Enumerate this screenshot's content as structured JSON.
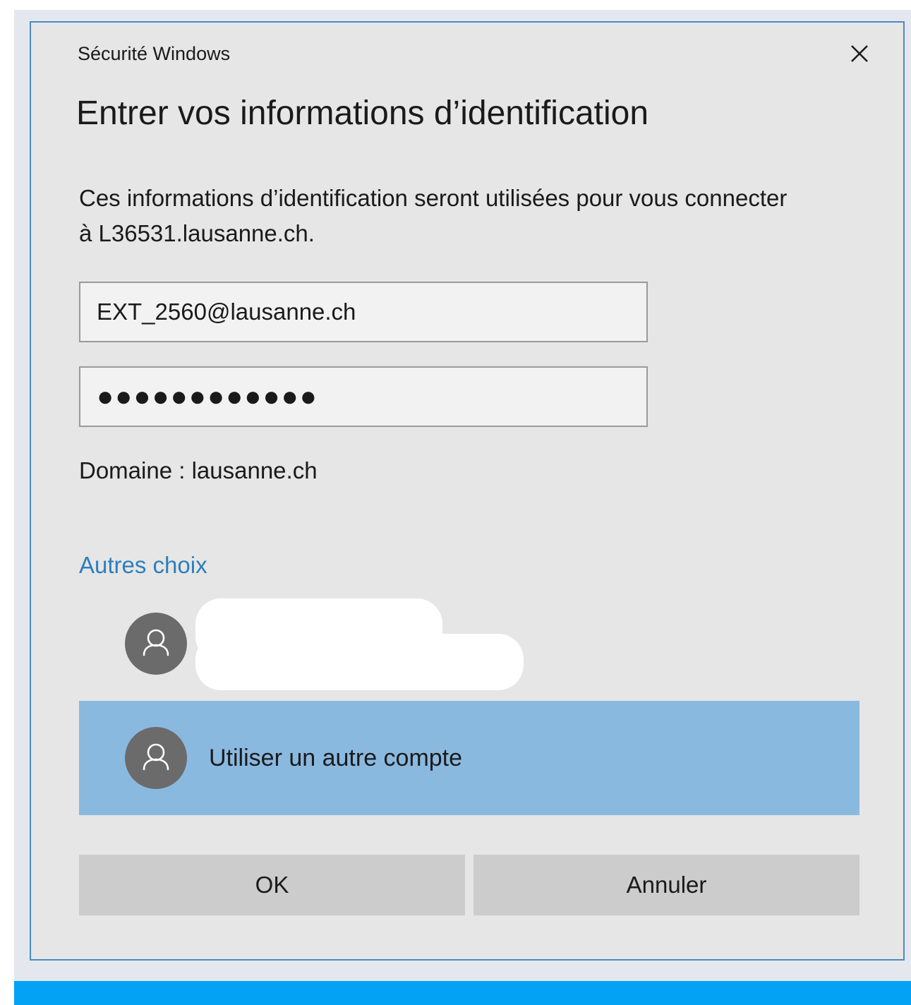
{
  "dialog": {
    "window_title": "Sécurité Windows",
    "heading": "Entrer vos informations d’identification",
    "description": "Ces informations d’identification seront utilisées pour vous connecter à L36531.lausanne.ch.",
    "username_value": "EXT_2560@lausanne.ch",
    "password_masked": "●●●●●●●●●●●●",
    "domain_text": "Domaine : lausanne.ch",
    "more_choices_label": "Autres choix",
    "accounts": [
      {
        "label": "",
        "icon": "user-avatar-icon",
        "selected": false
      },
      {
        "label": "Utiliser un autre compte",
        "icon": "user-avatar-icon",
        "selected": true
      }
    ],
    "ok_label": "OK",
    "cancel_label": "Annuler"
  },
  "colors": {
    "dialog_border": "#4a8ac2",
    "link": "#2c7fbd",
    "selected_row": "#8ab9e0",
    "taskbar": "#04a2f4"
  }
}
